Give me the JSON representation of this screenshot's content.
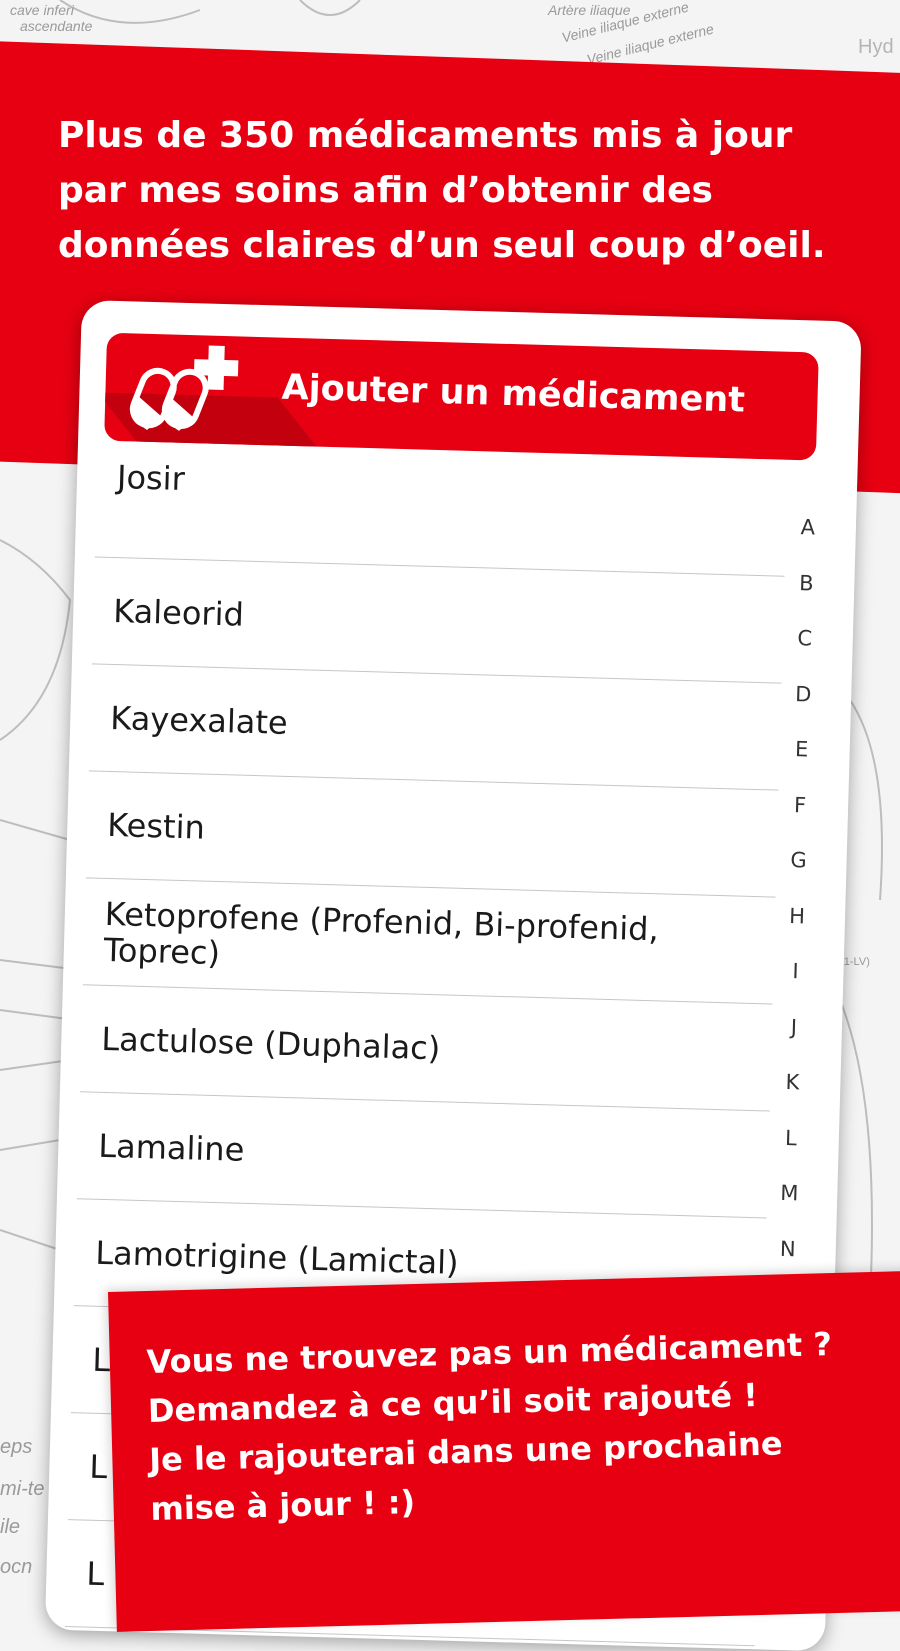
{
  "headline": {
    "lines": [
      "Plus de 350 médicaments mis à jour",
      "par mes soins afin d’obtenir des",
      "données claires d’un seul coup d’oeil."
    ]
  },
  "header": {
    "title": "Ajouter un médicament",
    "icon": "pills-plus-icon"
  },
  "medications": [
    "Josir",
    "Kaleorid",
    "Kayexalate",
    "Kestin",
    "Ketoprofene (Profenid, Bi-profenid, Toprec)",
    "Lactulose (Duphalac)",
    "Lamaline",
    "Lamotrigine (Lamictal)",
    "La",
    "L",
    "L"
  ],
  "alphabet_index": [
    "A",
    "B",
    "C",
    "D",
    "E",
    "F",
    "G",
    "H",
    "I",
    "J",
    "K",
    "L",
    "M",
    "N"
  ],
  "bottom_message": {
    "lines": [
      "Vous ne trouvez pas un médicament ?",
      "Demandez à ce qu’il soit rajouté !",
      "Je le rajouterai dans une prochaine",
      "mise à jour ! :)"
    ]
  },
  "background_labels": [
    "cave inferi",
    "ascendante",
    "Artère iliaque",
    "Veine iliaque externe",
    "Veine iliaque externe",
    "Hyd",
    "(L1-LV)",
    "eps",
    "mi-te",
    "ile",
    "ocn"
  ],
  "colors": {
    "brand_red": "#e70012",
    "dark_red": "#c3000e"
  }
}
